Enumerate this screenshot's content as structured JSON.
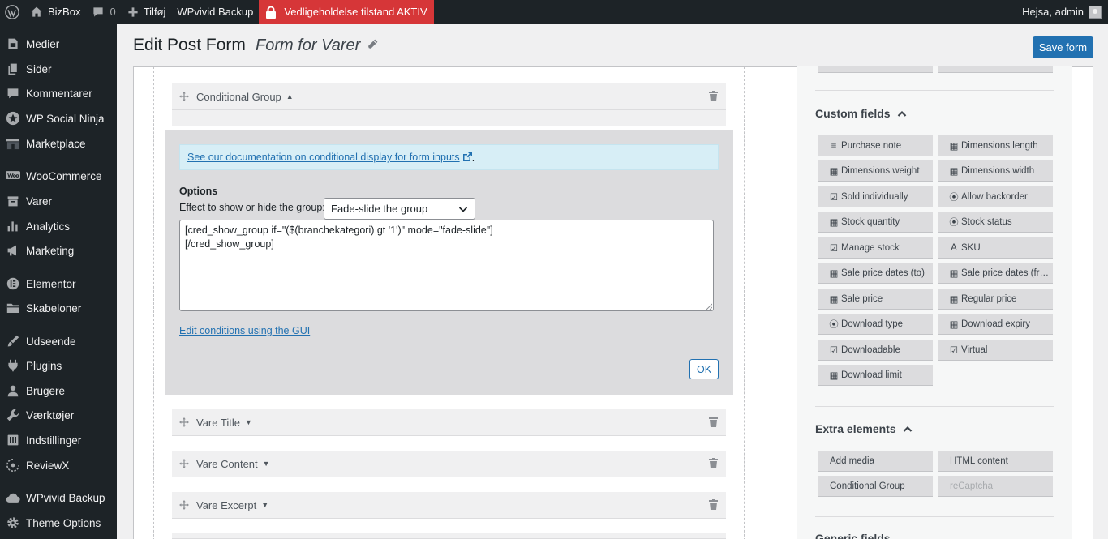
{
  "adminbar": {
    "site_name": "BizBox",
    "comments_count": "0",
    "add_new": "Tilføj",
    "wpvivid": "WPvivid Backup",
    "maintenance": "Vedligeholdelse tilstand AKTIV",
    "greeting": "Hejsa, admin"
  },
  "sidebar": {
    "items": [
      {
        "label": "Medier",
        "icon": "media-icon"
      },
      {
        "label": "Sider",
        "icon": "pages-icon"
      },
      {
        "label": "Kommentarer",
        "icon": "comments-icon"
      },
      {
        "label": "WP Social Ninja",
        "icon": "star-icon"
      },
      {
        "label": "Marketplace",
        "icon": "store-icon"
      },
      {
        "label": "WooCommerce",
        "icon": "woo-icon"
      },
      {
        "label": "Varer",
        "icon": "archive-icon"
      },
      {
        "label": "Analytics",
        "icon": "chart-icon"
      },
      {
        "label": "Marketing",
        "icon": "megaphone-icon"
      },
      {
        "label": "Elementor",
        "icon": "elementor-icon"
      },
      {
        "label": "Skabeloner",
        "icon": "folder-icon"
      },
      {
        "label": "Udseende",
        "icon": "brush-icon"
      },
      {
        "label": "Plugins",
        "icon": "plugin-icon"
      },
      {
        "label": "Brugere",
        "icon": "users-icon"
      },
      {
        "label": "Værktøjer",
        "icon": "wrench-icon"
      },
      {
        "label": "Indstillinger",
        "icon": "settings-icon"
      },
      {
        "label": "ReviewX",
        "icon": "reviewx-icon"
      },
      {
        "label": "WPvivid Backup",
        "icon": "cloud-icon"
      },
      {
        "label": "Theme Options",
        "icon": "gear-icon"
      }
    ]
  },
  "header": {
    "title": "Edit Post Form",
    "form_name": "Form for Varer",
    "save_label": "Save form"
  },
  "editor": {
    "group_label": "Conditional Group",
    "doc_link": "See our documentation on conditional display for form inputs",
    "doc_link_suffix": ".",
    "options_label": "Options",
    "effect_label": "Effect to show or hide the group:",
    "effect_value": "Fade-slide the group",
    "shortcode": "[cred_show_group if=\"($(branchekategori) gt '1')\" mode=\"fade-slide\"]\n[/cred_show_group]",
    "gui_link": "Edit conditions using the GUI",
    "ok_label": "OK",
    "fields": [
      {
        "label": "Vare Title"
      },
      {
        "label": "Vare Content"
      },
      {
        "label": "Vare Excerpt"
      }
    ]
  },
  "right": {
    "custom_fields_title": "Custom fields",
    "custom_fields": [
      {
        "label": "Purchase note",
        "icon": "lines-icon"
      },
      {
        "label": "Dimensions length",
        "icon": "calculator-icon"
      },
      {
        "label": "Dimensions weight",
        "icon": "calculator-icon"
      },
      {
        "label": "Dimensions width",
        "icon": "calculator-icon"
      },
      {
        "label": "Sold individually",
        "icon": "checkbox-icon"
      },
      {
        "label": "Allow backorder",
        "icon": "radio-icon"
      },
      {
        "label": "Stock quantity",
        "icon": "calculator-icon"
      },
      {
        "label": "Stock status",
        "icon": "radio-icon"
      },
      {
        "label": "Manage stock",
        "icon": "checkbox-icon"
      },
      {
        "label": "SKU",
        "icon": "font-icon"
      },
      {
        "label": "Sale price dates (to)",
        "icon": "calendar-icon"
      },
      {
        "label": "Sale price dates (fr…",
        "icon": "calendar-icon"
      },
      {
        "label": "Sale price",
        "icon": "calculator-icon"
      },
      {
        "label": "Regular price",
        "icon": "calculator-icon"
      },
      {
        "label": "Download type",
        "icon": "radio-icon"
      },
      {
        "label": "Download expiry",
        "icon": "calculator-icon"
      },
      {
        "label": "Downloadable",
        "icon": "checkbox-icon"
      },
      {
        "label": "Virtual",
        "icon": "checkbox-icon"
      },
      {
        "label": "Download limit",
        "icon": "calculator-icon"
      }
    ],
    "extra_title": "Extra elements",
    "extra": [
      {
        "label": "Add media"
      },
      {
        "label": "HTML content"
      },
      {
        "label": "Conditional Group"
      },
      {
        "label": "reCaptcha",
        "disabled": true
      }
    ],
    "generic_title": "Generic fields"
  },
  "colors": {
    "primary": "#2271b1",
    "adminbar": "#1d2327",
    "maintenance": "#d63638",
    "notice_bg": "#d7eef6"
  }
}
